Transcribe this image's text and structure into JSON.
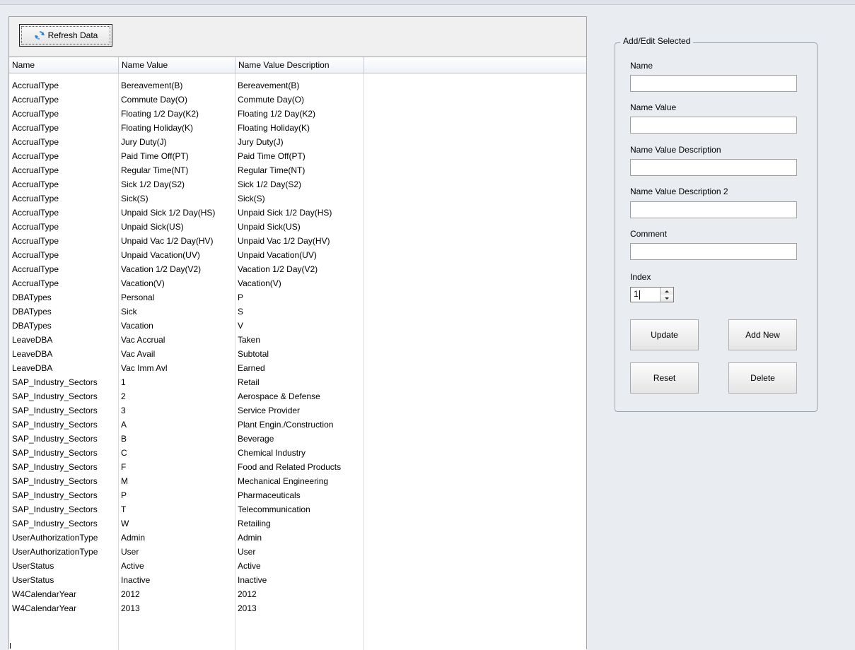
{
  "toolbar": {
    "refresh_label": "Refresh Data"
  },
  "table": {
    "columns": [
      "Name",
      "Name Value",
      "Name Value Description"
    ],
    "rows": [
      [
        "AccrualType",
        "Bereavement(B)",
        "Bereavement(B)"
      ],
      [
        "AccrualType",
        "Commute Day(O)",
        "Commute Day(O)"
      ],
      [
        "AccrualType",
        "Floating 1/2 Day(K2)",
        "Floating 1/2 Day(K2)"
      ],
      [
        "AccrualType",
        "Floating Holiday(K)",
        "Floating Holiday(K)"
      ],
      [
        "AccrualType",
        "Jury Duty(J)",
        "Jury Duty(J)"
      ],
      [
        "AccrualType",
        "Paid Time Off(PT)",
        "Paid Time Off(PT)"
      ],
      [
        "AccrualType",
        "Regular Time(NT)",
        "Regular Time(NT)"
      ],
      [
        "AccrualType",
        "Sick 1/2 Day(S2)",
        "Sick 1/2 Day(S2)"
      ],
      [
        "AccrualType",
        "Sick(S)",
        "Sick(S)"
      ],
      [
        "AccrualType",
        "Unpaid Sick 1/2 Day(HS)",
        "Unpaid Sick 1/2 Day(HS)"
      ],
      [
        "AccrualType",
        "Unpaid Sick(US)",
        "Unpaid Sick(US)"
      ],
      [
        "AccrualType",
        "Unpaid Vac 1/2 Day(HV)",
        "Unpaid Vac 1/2 Day(HV)"
      ],
      [
        "AccrualType",
        "Unpaid Vacation(UV)",
        "Unpaid Vacation(UV)"
      ],
      [
        "AccrualType",
        "Vacation 1/2 Day(V2)",
        "Vacation 1/2 Day(V2)"
      ],
      [
        "AccrualType",
        "Vacation(V)",
        "Vacation(V)"
      ],
      [
        "DBATypes",
        "Personal",
        "P"
      ],
      [
        "DBATypes",
        "Sick",
        "S"
      ],
      [
        "DBATypes",
        "Vacation",
        "V"
      ],
      [
        "LeaveDBA",
        "Vac Accrual",
        "Taken"
      ],
      [
        "LeaveDBA",
        "Vac Avail",
        "Subtotal"
      ],
      [
        "LeaveDBA",
        "Vac Imm Avl",
        "Earned"
      ],
      [
        "SAP_Industry_Sectors",
        "1",
        "Retail"
      ],
      [
        "SAP_Industry_Sectors",
        "2",
        "Aerospace & Defense"
      ],
      [
        "SAP_Industry_Sectors",
        "3",
        "Service Provider"
      ],
      [
        "SAP_Industry_Sectors",
        "A",
        "Plant Engin./Construction"
      ],
      [
        "SAP_Industry_Sectors",
        "B",
        "Beverage"
      ],
      [
        "SAP_Industry_Sectors",
        "C",
        "Chemical Industry"
      ],
      [
        "SAP_Industry_Sectors",
        "F",
        "Food and Related Products"
      ],
      [
        "SAP_Industry_Sectors",
        "M",
        "Mechanical Engineering"
      ],
      [
        "SAP_Industry_Sectors",
        "P",
        "Pharmaceuticals"
      ],
      [
        "SAP_Industry_Sectors",
        "T",
        "Telecommunication"
      ],
      [
        "SAP_Industry_Sectors",
        "W",
        "Retailing"
      ],
      [
        "UserAuthorizationType",
        "Admin",
        "Admin"
      ],
      [
        "UserAuthorizationType",
        "User",
        "User"
      ],
      [
        "UserStatus",
        "Active",
        "Active"
      ],
      [
        "UserStatus",
        "Inactive",
        "Inactive"
      ],
      [
        "W4CalendarYear",
        "2012",
        "2012"
      ],
      [
        "W4CalendarYear",
        "2013",
        "2013"
      ]
    ]
  },
  "edit": {
    "group_title": "Add/Edit Selected",
    "fields": [
      {
        "label": "Name",
        "value": ""
      },
      {
        "label": "Name Value",
        "value": ""
      },
      {
        "label": "Name Value Description",
        "value": ""
      },
      {
        "label": "Name Value Description 2",
        "value": ""
      },
      {
        "label": "Comment",
        "value": ""
      }
    ],
    "index_label": "Index",
    "index_value": "1",
    "buttons": {
      "update": "Update",
      "add_new": "Add New",
      "reset": "Reset",
      "delete": "Delete"
    }
  },
  "icons": {
    "refresh": "refresh-icon",
    "spin_up": "chevron-up-icon",
    "spin_down": "chevron-down-icon"
  },
  "colors": {
    "background": "#e9ecf1",
    "grid_background": "#ffffff",
    "header_border": "#b7c3d3"
  }
}
